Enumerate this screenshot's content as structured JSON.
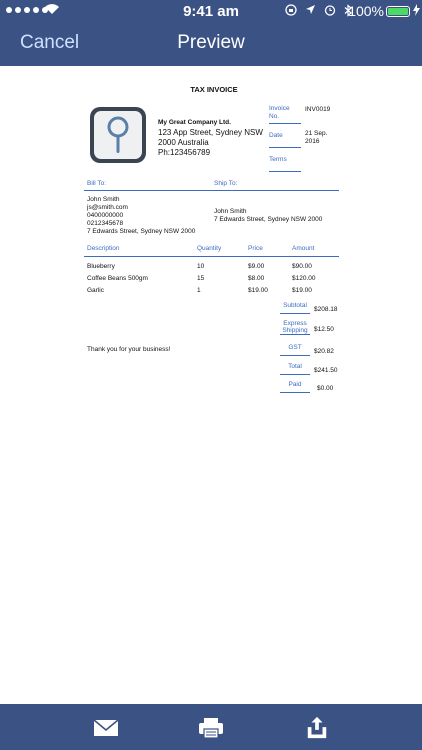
{
  "status_bar": {
    "time": "9:41 am",
    "battery": "100%"
  },
  "nav": {
    "cancel_label": "Cancel",
    "title": "Preview"
  },
  "invoice": {
    "title": "TAX INVOICE",
    "company": {
      "name": "My Great Company Ltd.",
      "address_line1": "123 App Street, Sydney NSW",
      "address_line2": "2000 Australia",
      "phone": "Ph:123456789"
    },
    "meta": {
      "invoice_no_label": "Invoice No.",
      "invoice_no_value": "INV0019",
      "date_label": "Date",
      "date_value": "21 Sep. 2016",
      "terms_label": "Terms",
      "terms_value": ""
    },
    "bill_to_label": "Bill To:",
    "ship_to_label": "Ship To:",
    "bill_to": {
      "name": "John Smith",
      "email": "js@smith.com",
      "phone1": "0400000000",
      "phone2": "0212345678",
      "address": "7 Edwards Street, Sydney NSW 2000"
    },
    "ship_to": {
      "name": "John Smith",
      "address": "7 Edwards Street, Sydney NSW 2000"
    },
    "columns": {
      "description": "Description",
      "quantity": "Quantity",
      "price": "Price",
      "amount": "Amount"
    },
    "items": [
      {
        "description": "Blueberry",
        "quantity": "10",
        "price": "$9.00",
        "amount": "$90.00"
      },
      {
        "description": "Coffee Beans 500gm",
        "quantity": "15",
        "price": "$8.00",
        "amount": "$120.00"
      },
      {
        "description": "Garlic",
        "quantity": "1",
        "price": "$19.00",
        "amount": "$19.00"
      }
    ],
    "totals": {
      "subtotal_label": "Subtotal",
      "subtotal_value": "$208.18",
      "shipping_label": "Express Shipping",
      "shipping_value": "$12.50",
      "gst_label": "GST",
      "gst_value": "$20.82",
      "total_label": "Total",
      "total_value": "$241.50",
      "paid_label": "Paid",
      "paid_value": "$0.00"
    },
    "thanks": "Thank you for your business!"
  },
  "toolbar": {
    "email_icon": "envelope-icon",
    "print_icon": "printer-icon",
    "share_icon": "share-icon"
  },
  "colors": {
    "nav_bg": "#3b5284",
    "accent_blue": "#3b6cc0",
    "battery_green": "#4cd964"
  }
}
